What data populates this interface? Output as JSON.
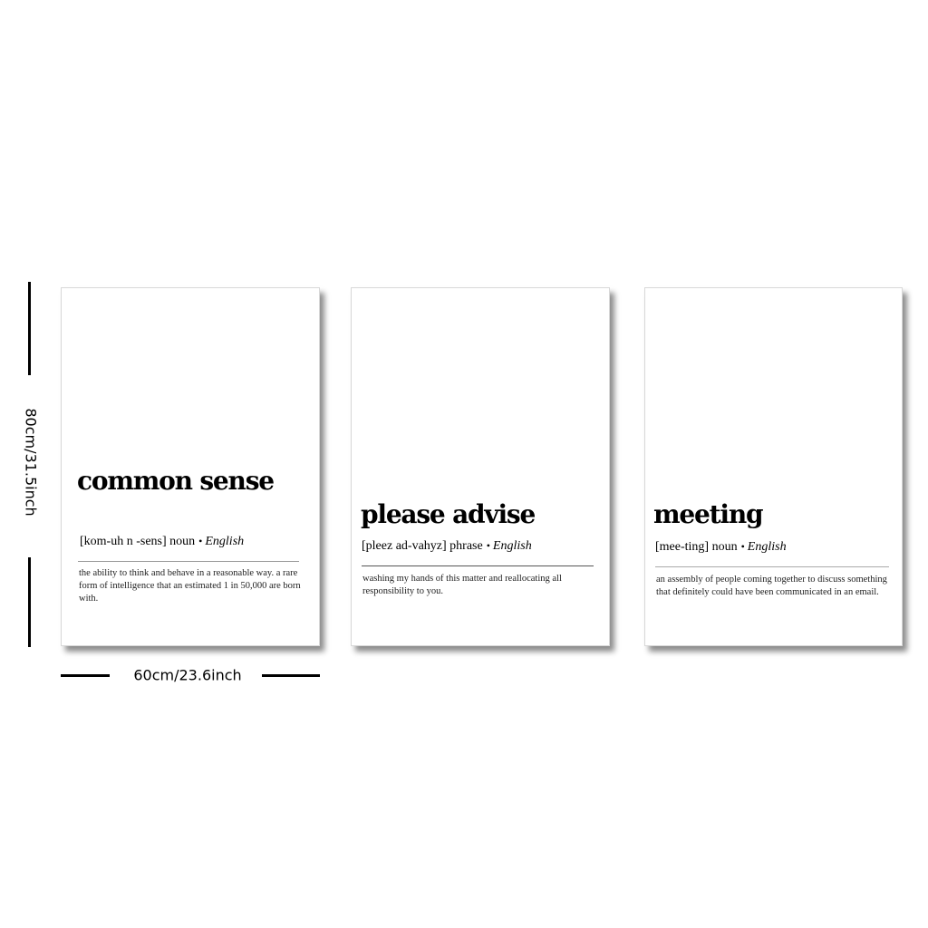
{
  "dimensions": {
    "height_label": "80cm/31.5inch",
    "width_label": "60cm/23.6inch"
  },
  "posters": [
    {
      "word": "common sense",
      "pronunciation": "[kom-uh n -sens]",
      "part_of_speech": "noun",
      "bullet": "•",
      "language": "English",
      "definition": "the ability to think and behave in a reasonable way. a rare form of intelligence that an estimated 1 in 50,000 are born with."
    },
    {
      "word": "please advise",
      "pronunciation": "[pleez ad-vahyz]",
      "part_of_speech": "phrase",
      "bullet": "•",
      "language": "English",
      "definition": "washing my hands of this matter and reallocating all responsibility to you."
    },
    {
      "word": "meeting",
      "pronunciation": "[mee-ting]",
      "part_of_speech": "noun",
      "bullet": "•",
      "language": "English",
      "definition": "an assembly of people coming together to discuss something that definitely could have been communicated in an email."
    }
  ]
}
